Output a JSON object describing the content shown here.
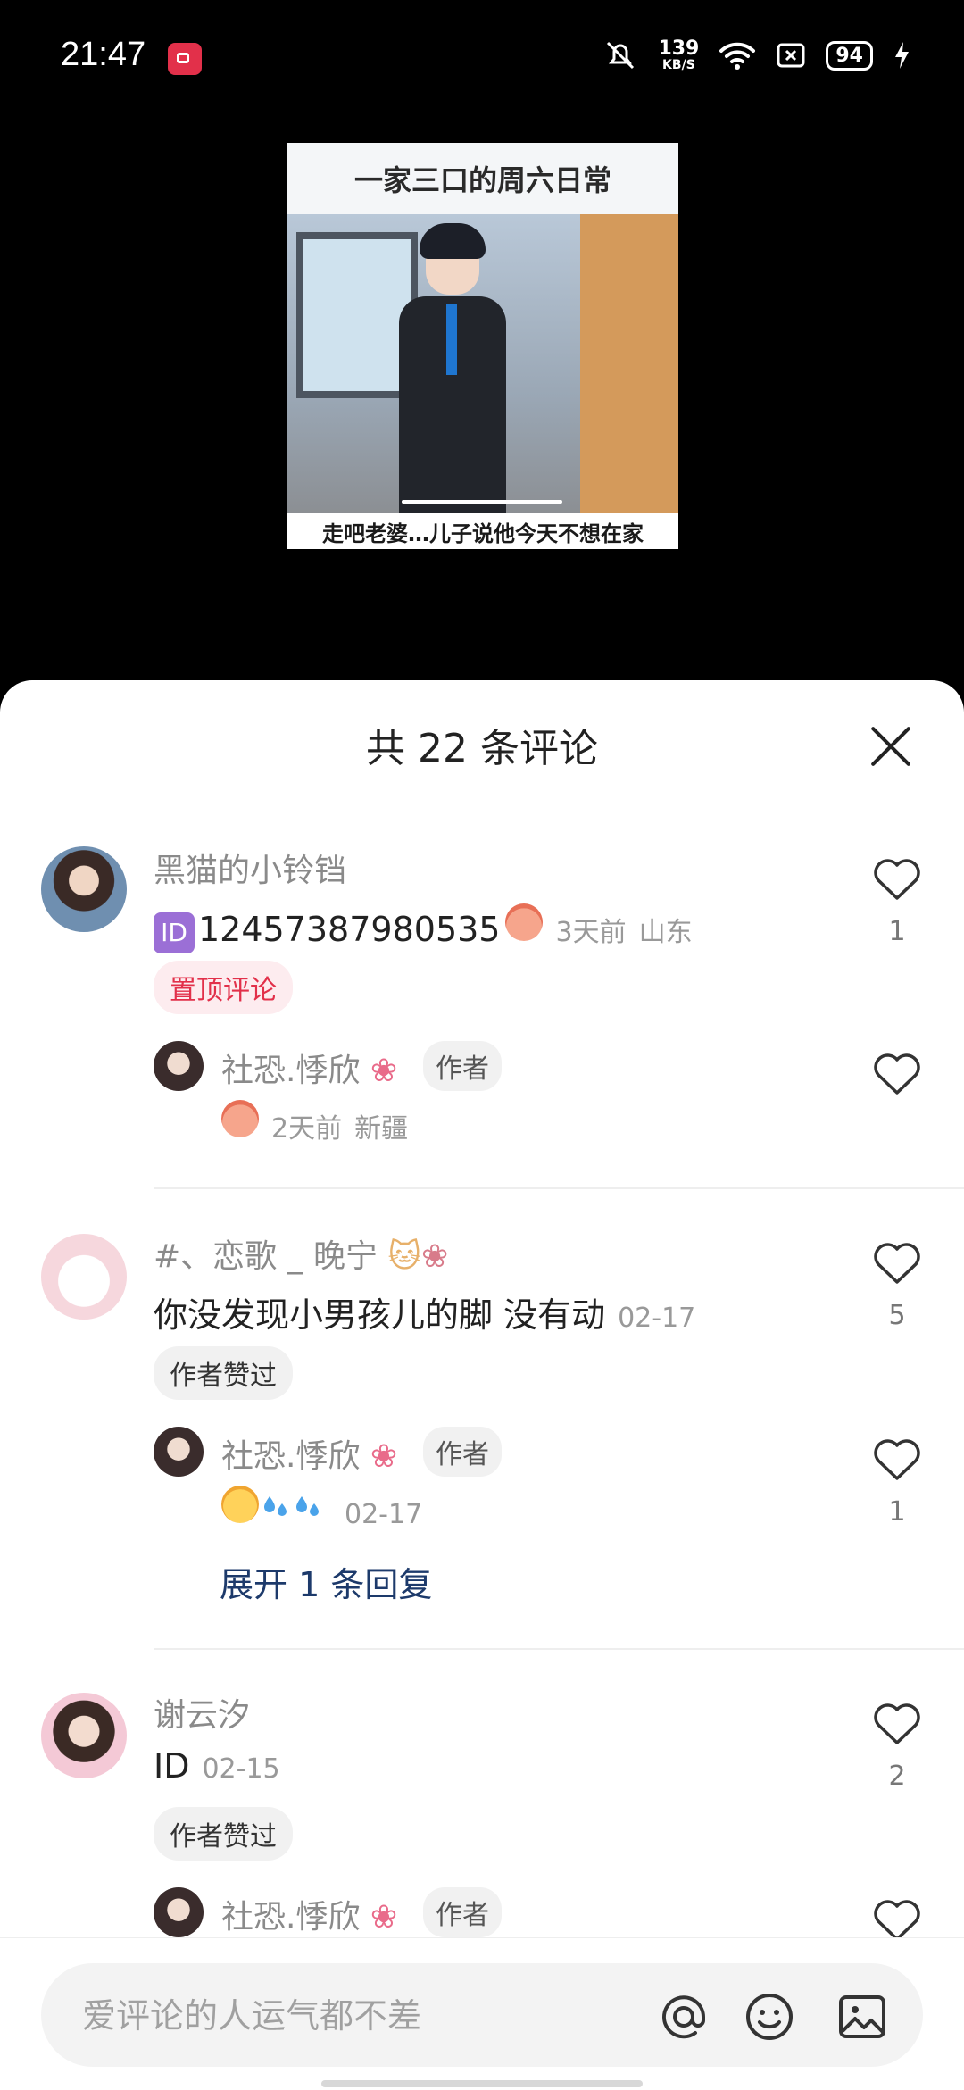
{
  "status_bar": {
    "time": "21:47",
    "net_speed_value": "139",
    "net_speed_unit": "KB/S",
    "battery": "94"
  },
  "video": {
    "title": "一家三口的周六日常",
    "subtitle": "走吧老婆…儿子说他今天不想在家"
  },
  "sheet": {
    "title": "共 22 条评论"
  },
  "comments": [
    {
      "user": "黑猫的小铃铛",
      "text": "12457387980535",
      "time": "3天前",
      "location": "山东",
      "tag": "置顶评论",
      "likes": "1",
      "reply": {
        "user": "社恐.悸欣",
        "author_label": "作者",
        "time": "2天前",
        "location": "新疆"
      }
    },
    {
      "user": "#、恋歌 _ 晚宁",
      "text": "你没发现小男孩儿的脚 没有动",
      "time": "02-17",
      "tag": "作者赞过",
      "likes": "5",
      "reply": {
        "user": "社恐.悸欣",
        "author_label": "作者",
        "time": "02-17",
        "likes": "1"
      },
      "expand_label": "展开 1 条回复"
    },
    {
      "user": "谢云汐",
      "text": "ID",
      "time": "02-15",
      "tag": "作者赞过",
      "likes": "2",
      "reply": {
        "user": "社恐.悸欣",
        "author_label": "作者"
      }
    }
  ],
  "input": {
    "placeholder": "爱评论的人运气都不差"
  },
  "colors": {
    "accent_red": "#e2304a",
    "link_blue": "#1d3a6b"
  }
}
